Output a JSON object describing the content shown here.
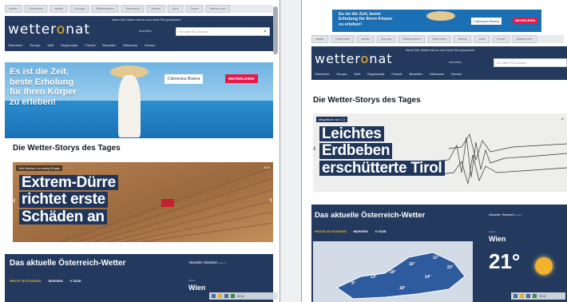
{
  "colors": {
    "brand_navy": "#233a5e",
    "accent_red": "#e5194a",
    "sun_yellow": "#f2b230",
    "sea_blue": "#1b6fb4"
  },
  "icons": {
    "search": "search-icon",
    "sun": "sun-icon",
    "prev": "chevron-left-icon",
    "next": "chevron-right-icon"
  },
  "left": {
    "topnav": [
      "wetter",
      "Österreich",
      "wetter",
      "Europa",
      "Wetterkarten",
      "Österreich",
      "Wetter",
      "Jobs",
      "Travel",
      "Wetter.com"
    ],
    "logo": {
      "pre": "wetter",
      "sun": "o",
      "post": "nat"
    },
    "tagline": "Meine Orte: Bisher hast du noch keine Orte gespeichert.",
    "login": "Anmelden",
    "search_placeholder": "Ort oder PLZ suchen",
    "menu": [
      "Österreich",
      "Europa",
      "Welt",
      "Regenradar",
      "Freizeit",
      "Biowetter",
      "Webcams",
      "Service"
    ],
    "ad": {
      "line1": "Es ist die Zeit,",
      "line2": "beste Erholung",
      "line3": "für Ihren Körper",
      "line4": "zu erleben!",
      "brand": "Crikvenica Riviera",
      "cta": "WEITERLESEN"
    },
    "section_title": "Die Wetter-Storys des Tages",
    "story": {
      "kicker": "Seit Wochen zu wenig Regen",
      "line1": "Extrem-Dürre",
      "line2": "richtet erste",
      "line3": "Schäden an",
      "counter": "3/10"
    },
    "weather": {
      "title": "Das aktuelle Österreich-Wetter",
      "tabs": [
        "HEUTE 48 STUNDEN",
        "MORGEN",
        "9 TAGE"
      ],
      "location_label": "Aktueller Standort",
      "location_sub": "ändern",
      "sublabel": "Wetter",
      "city": "Wien"
    },
    "clock": "09:42"
  },
  "right": {
    "ad": {
      "line1": "Es ist die Zeit, beste",
      "line2": "Erholung für Ihren Körper",
      "line3": "zu erleben!",
      "brand": "Crikvenica Riviera",
      "cta": "WEITERLESEN"
    },
    "topnav": [
      "wetter",
      "Österreich",
      "wetter",
      "Europa",
      "Wetterkarten",
      "Österreich",
      "Wetter",
      "Jobs",
      "Travel",
      "Wetter.com"
    ],
    "logo": {
      "pre": "wetter",
      "sun": "o",
      "post": "nat"
    },
    "tagline": "Meine Orte: Bisher hast du noch keine Orte gespeichert.",
    "login": "Anmelden",
    "search_placeholder": "Ort oder PLZ suchen",
    "menu": [
      "Österreich",
      "Europa",
      "Welt",
      "Regenradar",
      "Freizeit",
      "Biowetter",
      "Webcams",
      "Service"
    ],
    "section_title": "Die Wetter-Storys des Tages",
    "story": {
      "kicker": "Magnitude von 2,3",
      "line1": "Leichtes",
      "line2": "Erdbeben",
      "line3": "erschütterte Tirol",
      "counter": "4/"
    },
    "weather": {
      "title": "Das aktuelle Österreich-Wetter",
      "tabs": [
        "HEUTE 48 STUNDEN",
        "MORGEN",
        "9 TAGE"
      ],
      "location_label": "Aktueller Standort",
      "location_sub": "ändern",
      "sublabel": "Wetter",
      "city": "Wien",
      "temp": "21°",
      "map_temps": [
        "9°",
        "13°",
        "10°",
        "16°",
        "11°",
        "14°",
        "21°",
        "18°"
      ]
    },
    "clock": "09:42"
  }
}
